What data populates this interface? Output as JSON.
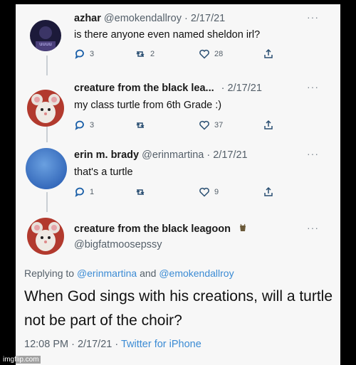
{
  "tweets": [
    {
      "name": "azhar",
      "handle": "@emokendallroy",
      "date": "· 2/17/21",
      "text": "is there anyone even named sheldon irl?",
      "replies": "3",
      "retweets": "2",
      "likes": "28",
      "more": "···"
    },
    {
      "name": "creature from the black lea...",
      "handle": "",
      "date": "· 2/17/21",
      "text": "my class turtle from 6th Grade :)",
      "replies": "3",
      "retweets": "",
      "likes": "37",
      "more": "···"
    },
    {
      "name": "erin m. brady",
      "handle": "@erinmartina",
      "date": "· 2/17/21",
      "text": "that's a turtle",
      "replies": "1",
      "retweets": "",
      "likes": "9",
      "more": "···"
    }
  ],
  "main_tweet": {
    "name": "creature from the black leagoon",
    "handle": "@bigfatmoosepssy",
    "more": "···",
    "replying_prefix": "Replying to",
    "reply_user1": "@erinmartina",
    "reply_and": "and",
    "reply_user2": "@emokendallroy",
    "text": "When God sings with his creations, will a turtle not be part of the choir?",
    "time": "12:08 PM · 2/17/21 ·",
    "app": "Twitter for iPhone"
  },
  "watermark": "imgflip.com",
  "colors": {
    "link": "#3b8bd4",
    "secondary": "#55606a",
    "background": "#f7f7f7"
  }
}
